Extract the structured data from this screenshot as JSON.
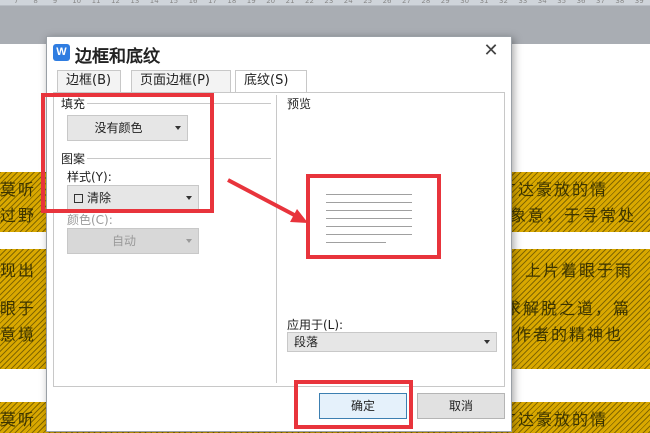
{
  "ruler": {
    "ticks": [
      "7",
      "8",
      "9",
      "10",
      "11",
      "12",
      "13",
      "14",
      "15",
      "16",
      "17",
      "18",
      "19",
      "20",
      "21",
      "22",
      "23",
      "24",
      "25",
      "26",
      "27",
      "28",
      "29",
      "30",
      "31",
      "32",
      "33",
      "34",
      "35",
      "36",
      "37",
      "38",
      "39"
    ]
  },
  "document": {
    "lines": [
      {
        "left": "莫听",
        "right": "旷达豪放的情"
      },
      {
        "left": "过野",
        "right": "象意，于寻常处"
      },
      {
        "left": "现出",
        "right": "上片着眼于雨"
      },
      {
        "left": "眼于",
        "right": "求解脱之道，篇"
      },
      {
        "left": "意境",
        "right": "作者的精神也"
      },
      {
        "left": "莫听",
        "right": "旷达豪放的情"
      }
    ]
  },
  "dialog": {
    "app_icon_letter": "W",
    "title": "边框和底纹",
    "close_symbol": "✕",
    "tabs": [
      {
        "label": "边框(B)"
      },
      {
        "label": "页面边框(P)"
      },
      {
        "label": "底纹(S)"
      }
    ],
    "fill": {
      "group_label": "填充",
      "color_value": "没有颜色"
    },
    "pattern": {
      "group_label": "图案",
      "style_label": "样式(Y):",
      "style_value": "清除",
      "color_label": "颜色(C):",
      "color_value": "自动"
    },
    "preview": {
      "label": "预览"
    },
    "apply_to": {
      "label": "应用于(L):",
      "value": "段落"
    },
    "buttons": {
      "ok": "确定",
      "cancel": "取消"
    }
  }
}
